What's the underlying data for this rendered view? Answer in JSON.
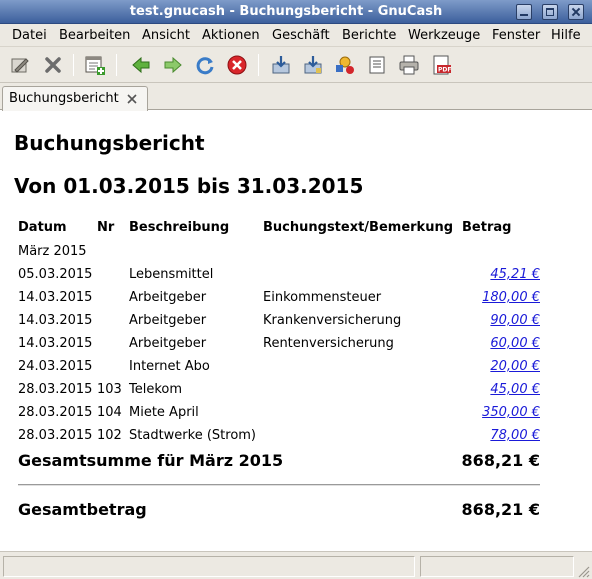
{
  "window": {
    "title": "test.gnucash - Buchungsbericht - GnuCash"
  },
  "menubar": {
    "items": [
      "Datei",
      "Bearbeiten",
      "Ansicht",
      "Aktionen",
      "Geschäft",
      "Berichte",
      "Werkzeuge",
      "Fenster",
      "Hilfe"
    ]
  },
  "toolbar": {
    "buttons": [
      "edit-icon",
      "close-icon",
      "new-account-icon",
      "back-icon",
      "forward-icon",
      "reload-icon",
      "stop-icon",
      "export-icon",
      "save-report-icon",
      "options-icon",
      "page-setup-icon",
      "print-icon",
      "pdf-icon"
    ]
  },
  "tab": {
    "label": "Buchungsbericht"
  },
  "report": {
    "title": "Buchungsbericht",
    "period": "Von 01.03.2015 bis 31.03.2015",
    "columns": {
      "date": "Datum",
      "num": "Nr",
      "description": "Beschreibung",
      "memo": "Buchungstext/Bemerkung",
      "amount": "Betrag"
    },
    "group": "März 2015",
    "rows": [
      {
        "date": "05.03.2015",
        "num": "",
        "description": "Lebensmittel",
        "memo": "",
        "amount": "45,21 €"
      },
      {
        "date": "14.03.2015",
        "num": "",
        "description": "Arbeitgeber",
        "memo": "Einkommensteuer",
        "amount": "180,00 €"
      },
      {
        "date": "14.03.2015",
        "num": "",
        "description": "Arbeitgeber",
        "memo": "Krankenversicherung",
        "amount": "90,00 €"
      },
      {
        "date": "14.03.2015",
        "num": "",
        "description": "Arbeitgeber",
        "memo": "Rentenversicherung",
        "amount": "60,00 €"
      },
      {
        "date": "24.03.2015",
        "num": "",
        "description": "Internet Abo",
        "memo": "",
        "amount": "20,00 €"
      },
      {
        "date": "28.03.2015",
        "num": "103",
        "description": "Telekom",
        "memo": "",
        "amount": "45,00 €"
      },
      {
        "date": "28.03.2015",
        "num": "104",
        "description": "Miete April",
        "memo": "",
        "amount": "350,00 €"
      },
      {
        "date": "28.03.2015",
        "num": "102",
        "description": "Stadtwerke (Strom)",
        "memo": "",
        "amount": "78,00 €"
      }
    ],
    "subtotal": {
      "label": "Gesamtsumme für März 2015",
      "value": "868,21 €"
    },
    "grandtotal": {
      "label": "Gesamtbetrag",
      "value": "868,21 €"
    }
  },
  "statusbar": {
    "text": ""
  }
}
